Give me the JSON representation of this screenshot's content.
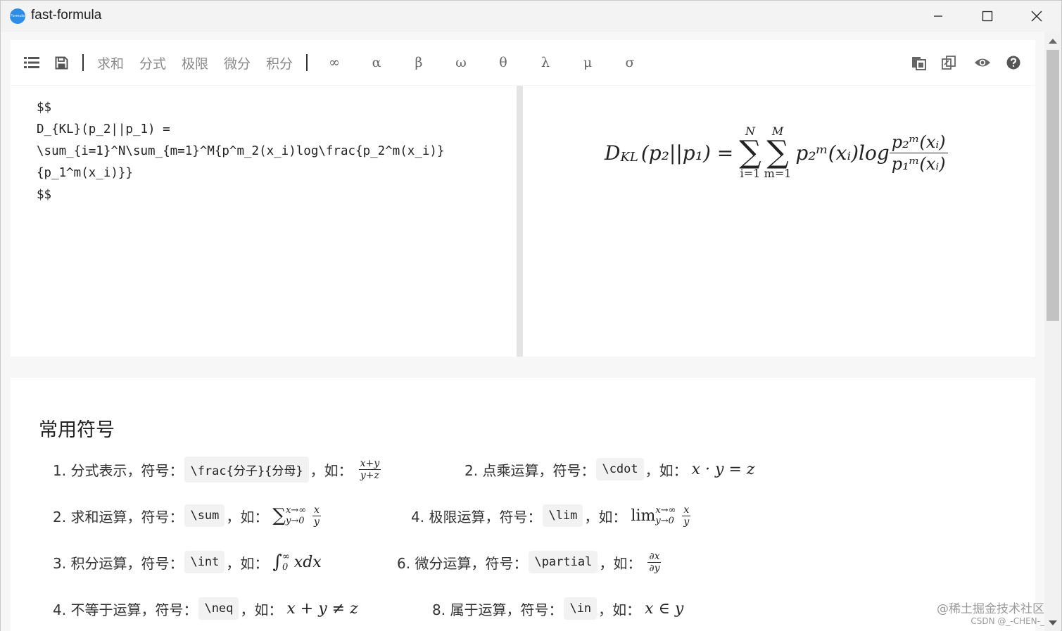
{
  "window": {
    "title": "fast-formula",
    "icon_text": "Formula",
    "minimize_icon": "minimize-icon",
    "maximize_icon": "maximize-icon",
    "close_icon": "close-icon"
  },
  "toolbar": {
    "left_icons": [
      "list-icon",
      "save-icon"
    ],
    "categories": [
      "求和",
      "分式",
      "极限",
      "微分",
      "积分"
    ],
    "symbols": [
      "∞",
      "α",
      "β",
      "ω",
      "θ",
      "λ",
      "μ",
      "σ"
    ],
    "right_icons": [
      "copy-icon",
      "paste-icon",
      "eye-icon",
      "help-icon"
    ]
  },
  "editor": {
    "content": "$$\nD_{KL}(p_2||p_1) =\n\\sum_{i=1}^N\\sum_{m=1}^M{p^m_2(x_i)log\\frac{p_2^m(x_i)}\n{p_1^m(x_i)}}\n$$"
  },
  "preview": {
    "lhs": "D",
    "lhs_sub": "KL",
    "lhs_args": "(p₂||p₁) =",
    "sum1_upper": "N",
    "sum1_lower": "i=1",
    "sum2_upper": "M",
    "sum2_lower": "m=1",
    "term": "p₂ᵐ(xᵢ)log",
    "frac_num": "p₂ᵐ(xᵢ)",
    "frac_den": "p₁ᵐ(xᵢ)"
  },
  "reference": {
    "title": "常用符号",
    "items": [
      {
        "label": "1. 分式表示，符号：",
        "code": "\\frac{分子}{分母}",
        "sep": "，如：",
        "example_num": "x+y",
        "example_den": "y+z"
      },
      {
        "label": "2. 点乘运算，符号：",
        "code": "\\cdot",
        "sep": "，如：",
        "example": "x · y = z"
      },
      {
        "label": "2. 求和运算，符号：",
        "code": "\\sum",
        "sep": "，如：",
        "example": "∑",
        "example_sup": "x→∞",
        "example_sub": "y→0",
        "example_num": "x",
        "example_den": "y"
      },
      {
        "label": "4. 极限运算，符号：",
        "code": "\\lim",
        "sep": "，如：",
        "example": "lim",
        "example_sup": "x→∞",
        "example_sub": "y→0",
        "example_num": "x",
        "example_den": "y"
      },
      {
        "label": "3. 积分运算，符号：",
        "code": "\\int",
        "sep": "，如：",
        "example": "∫",
        "example_sup": "∞",
        "example_sub": "0",
        "example_tail": "xdx"
      },
      {
        "label": "6. 微分运算，符号：",
        "code": "\\partial",
        "sep": "，如：",
        "example_num": "∂x",
        "example_den": "∂y"
      },
      {
        "label": "4. 不等于运算，符号：",
        "code": "\\neq",
        "sep": "，如：",
        "example": "x + y ≠ z"
      },
      {
        "label": "8. 属于运算，符号：",
        "code": "\\in",
        "sep": "，如：",
        "example": "x ∈ y"
      }
    ]
  },
  "watermark": {
    "line1": "@稀土掘金技术社区",
    "line2": "CSDN @_-CHEN-_"
  }
}
